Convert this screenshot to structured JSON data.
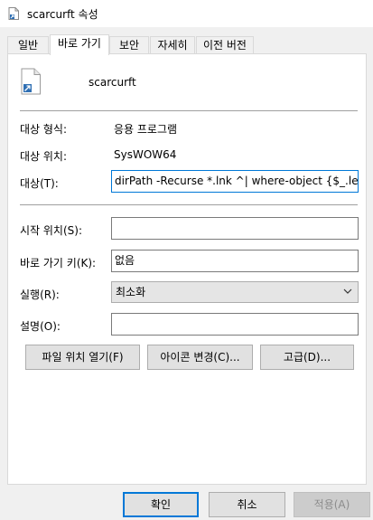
{
  "window": {
    "title": "scarcurft 속성"
  },
  "tabs": [
    {
      "label": "일반",
      "active": false
    },
    {
      "label": "바로 가기",
      "active": true
    },
    {
      "label": "보안",
      "active": false
    },
    {
      "label": "자세히",
      "active": false
    },
    {
      "label": "이전 버전",
      "active": false
    }
  ],
  "file": {
    "name": "scarcurft",
    "icon": "shortcut-file-icon"
  },
  "fields": {
    "target_type_label": "대상 형식:",
    "target_type_value": "응용 프로그램",
    "target_location_label": "대상 위치:",
    "target_location_value": "SysWOW64",
    "target_label": "대상(T):",
    "target_value": "dirPath -Recurse *.lnk ^| where-object {$_.length",
    "start_in_label": "시작 위치(S):",
    "start_in_value": "",
    "shortcut_key_label": "바로 가기 키(K):",
    "shortcut_key_value": "없음",
    "run_label": "실행(R):",
    "run_value": "최소화",
    "comment_label": "설명(O):",
    "comment_value": ""
  },
  "actions": {
    "open_location": "파일 위치 열기(F)",
    "change_icon": "아이콘 변경(C)...",
    "advanced": "고급(D)..."
  },
  "footer": {
    "ok": "확인",
    "cancel": "취소",
    "apply": "적용(A)"
  },
  "colors": {
    "accent": "#0078d7",
    "dialog_bg": "#f0f0f0"
  }
}
